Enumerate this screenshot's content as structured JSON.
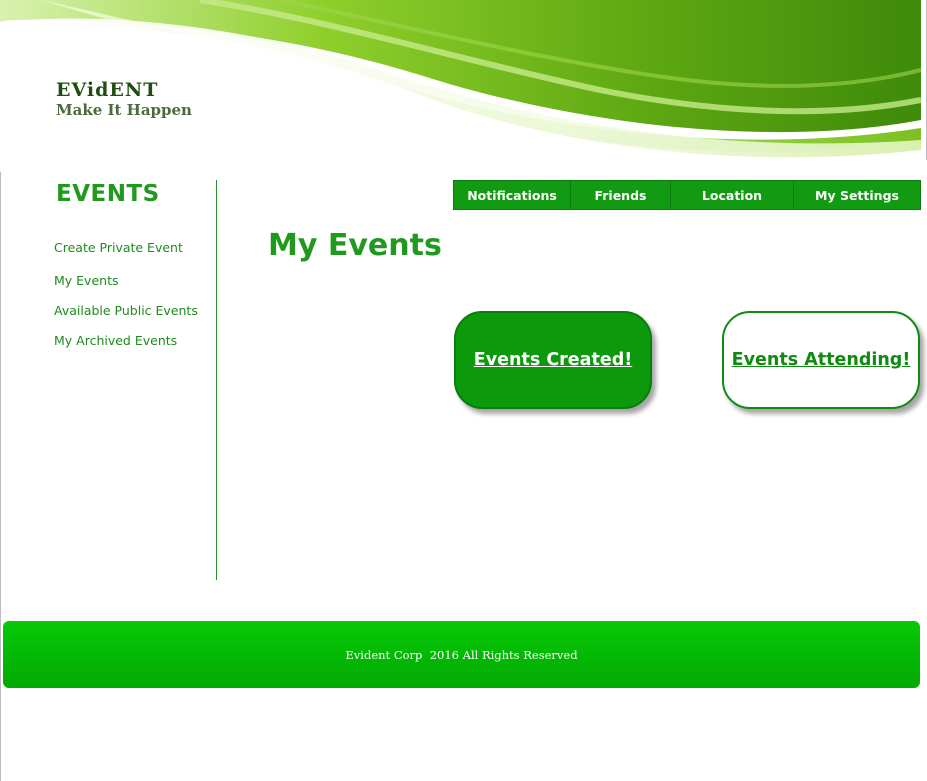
{
  "brand": {
    "name": "EVidENT",
    "tagline": "Make It Happen"
  },
  "sidebar": {
    "title": "EVENTS",
    "items": [
      {
        "label": "Create Private Event"
      },
      {
        "label": "My Events"
      },
      {
        "label": "Available Public Events"
      },
      {
        "label": "My Archived Events"
      }
    ]
  },
  "topnav": {
    "items": [
      {
        "label": "Notifications"
      },
      {
        "label": "Friends"
      },
      {
        "label": "Location"
      },
      {
        "label": "My Settings"
      }
    ]
  },
  "main": {
    "title": "My Events",
    "buttons": {
      "created": "Events Created!",
      "attending": "Events Attending!"
    }
  },
  "footer": {
    "text": "Evident Corp  2016 All Rights Reserved"
  },
  "colors": {
    "accent": "#1f9a1f",
    "nav": "#129b12",
    "footer": "#06c906"
  }
}
